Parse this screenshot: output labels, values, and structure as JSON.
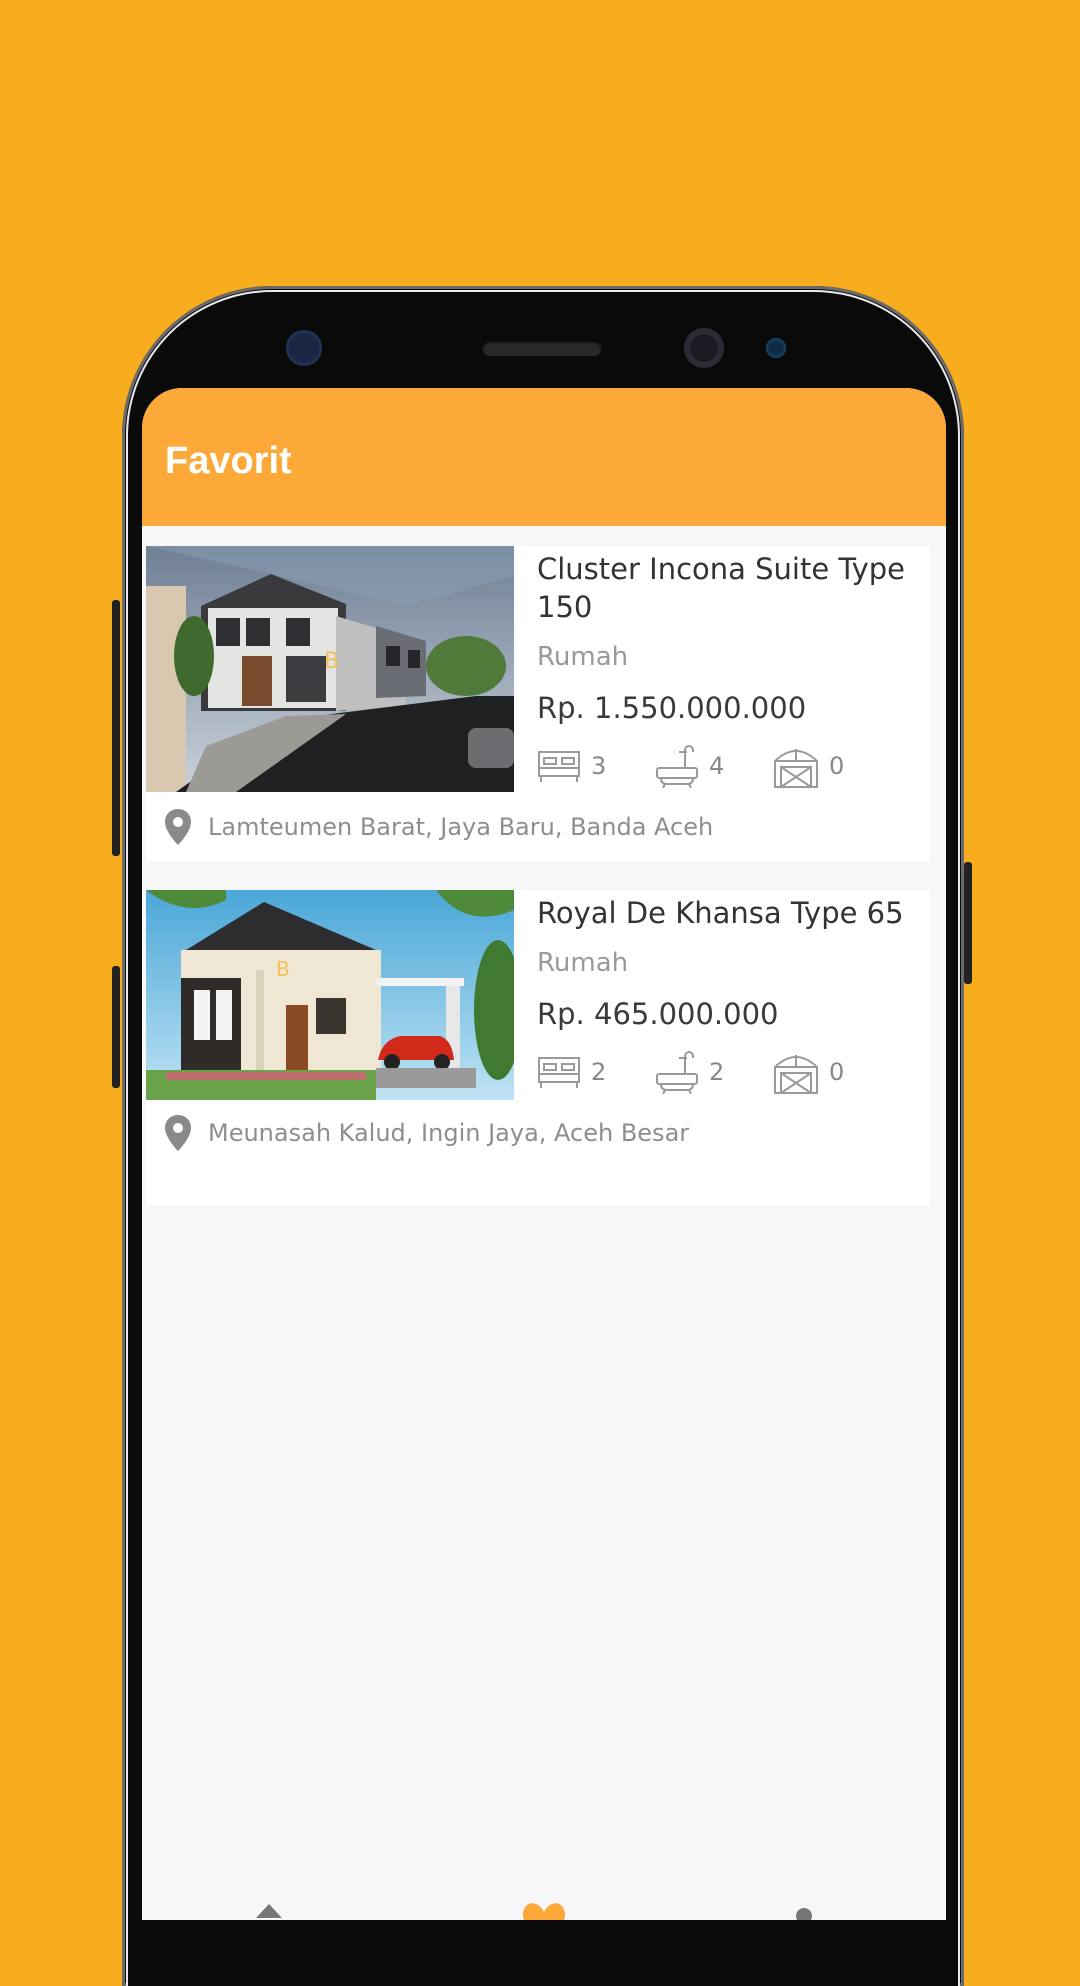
{
  "appbar": {
    "title": "Favorit"
  },
  "listings": [
    {
      "title": "Cluster Incona Suite Type 150",
      "type": "Rumah",
      "price": "Rp. 1.550.000.000",
      "bedrooms": "3",
      "bathrooms": "4",
      "garage": "0",
      "location": "Lamteumen Barat, Jaya Baru, Banda Aceh"
    },
    {
      "title": "Royal De Khansa Type 65",
      "type": "Rumah",
      "price": "Rp. 465.000.000",
      "bedrooms": "2",
      "bathrooms": "2",
      "garage": "0",
      "location": "Meunasah Kalud, Ingin Jaya, Aceh Besar"
    }
  ],
  "icons": {
    "bedroom": "bed-icon",
    "bathroom": "bathtub-icon",
    "garage": "garage-icon",
    "location": "location-pin-icon"
  },
  "colors": {
    "background": "#F8AD1E",
    "appbar": "#FDA93A",
    "accent": "#FDA93A"
  }
}
